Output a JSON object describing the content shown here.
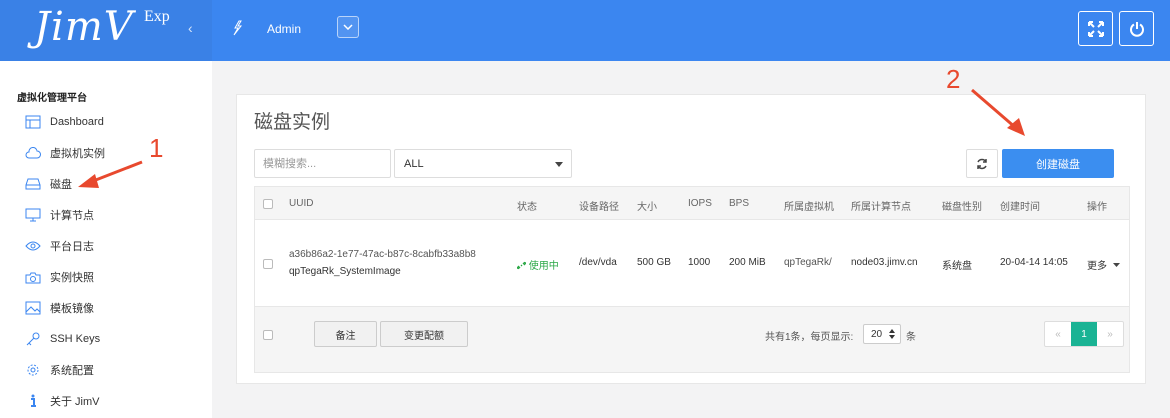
{
  "header": {
    "logo": "JimV",
    "logo_sup": "Exp",
    "collapse_icon": "chevron-left-icon",
    "user_name": "Admin",
    "fullscreen_icon": "expand-icon",
    "power_icon": "power-icon"
  },
  "sidebar": {
    "title": "虚拟化管理平台",
    "items": [
      {
        "label": "Dashboard",
        "icon": "dashboard-icon"
      },
      {
        "label": "虚拟机实例",
        "icon": "cloud-icon"
      },
      {
        "label": "磁盘",
        "icon": "disk-icon"
      },
      {
        "label": "计算节点",
        "icon": "monitor-icon"
      },
      {
        "label": "平台日志",
        "icon": "eye-icon"
      },
      {
        "label": "实例快照",
        "icon": "camera-icon"
      },
      {
        "label": "模板镜像",
        "icon": "image-icon"
      },
      {
        "label": "SSH Keys",
        "icon": "key-icon"
      },
      {
        "label": "系统配置",
        "icon": "gear-icon"
      },
      {
        "label": "关于 JimV",
        "icon": "info-icon"
      }
    ]
  },
  "main": {
    "title": "磁盘实例",
    "search_placeholder": "模糊搜索...",
    "filter_value": "ALL",
    "create_button": "创建磁盘",
    "columns": [
      "UUID",
      "状态",
      "设备路径",
      "大小",
      "IOPS",
      "BPS",
      "所属虚拟机",
      "所属计算节点",
      "磁盘性别",
      "创建时间",
      "操作"
    ],
    "rows": [
      {
        "uuid": "a36b86a2-1e77-47ac-b87c-8cabfb33a8b8",
        "label": "qpTegaRk_SystemImage",
        "status": "使用中",
        "path": "/dev/vda",
        "size": "500 GB",
        "iops": "1000",
        "bps": "200 MiB",
        "vm": "qpTegaRk/",
        "node": "node03.jimv.cn",
        "kind": "系统盘",
        "created": "20-04-14 14:05",
        "action": "更多"
      }
    ],
    "footer_buttons": [
      "备注",
      "变更配额"
    ],
    "pagination_prefix": "共有1条，每页显示:",
    "page_size": "20",
    "pagination_suffix": "条",
    "pages": [
      "«",
      "1",
      "»"
    ]
  },
  "annotations": [
    "1",
    "2"
  ],
  "colors": {
    "topbar": "#3b86f0",
    "primary_button": "#3b8ef0",
    "active_page": "#1ab394",
    "status_ok": "#2aa745",
    "annotation": "#e8492e"
  }
}
